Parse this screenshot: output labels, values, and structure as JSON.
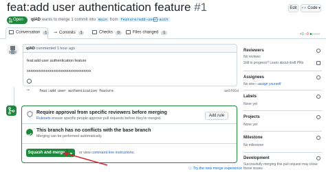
{
  "header": {
    "title": "feat:add user authentication feature",
    "number": "#1",
    "edit_label": "Edit",
    "code_label": "Code"
  },
  "status": {
    "badge": "Open",
    "author": "qIAD",
    "action_text": "wants to merge 1 commit into",
    "base_branch": "main",
    "from_text": "from",
    "head_branch": "feature/add-user-auth"
  },
  "tabs": [
    {
      "label": "Conversation",
      "count": "1"
    },
    {
      "label": "Commits",
      "count": "1"
    },
    {
      "label": "Checks",
      "count": "0"
    },
    {
      "label": "Files changed",
      "count": "1"
    }
  ],
  "diffstat": {
    "add": "+1",
    "del": "−0"
  },
  "comment": {
    "author": "qIAD",
    "meta": "commented 1 hour ago",
    "line1": "feat:add user authentication feature",
    "line2": "xxxxxxxxxxxxxxxxxxxxxxxxxxxxxxxxxx"
  },
  "commit": {
    "message": "feat:add user authentication feature",
    "sha": "ae5f05d"
  },
  "merge": {
    "approval_title": "Require approval from specific reviewers before merging",
    "rulesets_link": "Rulesets",
    "approval_desc": "ensure specific people approve pull requests before they're merged.",
    "add_rule": "Add rule",
    "noconflict_title": "This branch has no conflicts with the base branch",
    "noconflict_desc": "Merging can be performed automatically.",
    "squash_label": "Squash and merge",
    "or_text": "or view",
    "cli_link": "command line instructions",
    "cli_suffix": ".",
    "try_link": "Try the new merge experience"
  },
  "sidebar": {
    "reviewers": {
      "label": "Reviewers",
      "line1": "No reviews",
      "line2": "Still in progress? Learn about draft PRs"
    },
    "assignees": {
      "label": "Assignees",
      "none": "No one—",
      "assign": "assign yourself"
    },
    "labels": {
      "label": "Labels",
      "value": "None yet"
    },
    "projects": {
      "label": "Projects",
      "value": "None yet"
    },
    "milestone": {
      "label": "Milestone",
      "value": "No milestone"
    },
    "development": {
      "label": "Development",
      "value": "Successfully merging this pull request may close these issues."
    }
  }
}
